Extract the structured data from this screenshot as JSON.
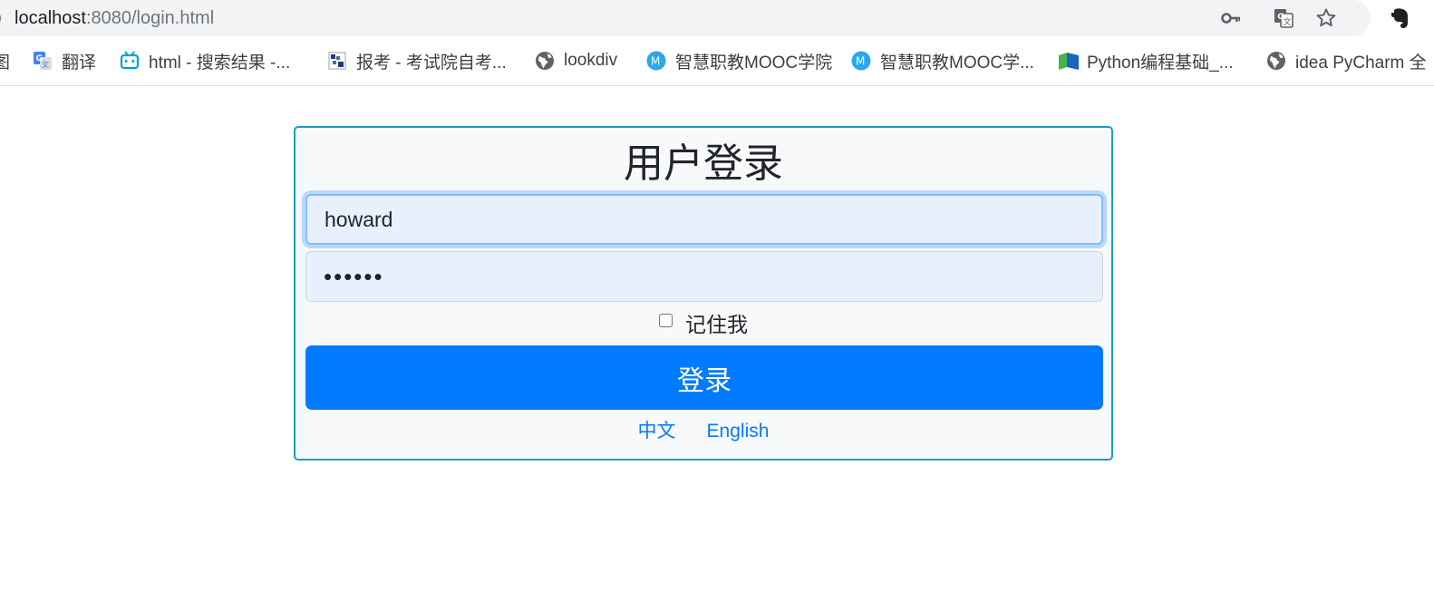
{
  "browser": {
    "url_host": "localhost",
    "url_path": ":8080/login.html",
    "icons": [
      "info-icon",
      "key-icon",
      "translate-icon",
      "star-icon",
      "evernote-icon"
    ]
  },
  "bookmarks": [
    {
      "label": "图",
      "icon": "image-icon"
    },
    {
      "label": "翻译",
      "icon": "google-translate-icon"
    },
    {
      "label": "html - 搜索结果 -...",
      "icon": "bilibili-icon"
    },
    {
      "label": "报考 - 考试院自考...",
      "icon": "site-icon"
    },
    {
      "label": "lookdiv",
      "icon": "globe-icon"
    },
    {
      "label": "智慧职教MOOC学院",
      "icon": "mooc-icon"
    },
    {
      "label": "智慧职教MOOC学...",
      "icon": "mooc-icon"
    },
    {
      "label": "Python编程基础_...",
      "icon": "flag-icon"
    },
    {
      "label": "idea PyCharm 全",
      "icon": "globe-icon"
    }
  ],
  "login": {
    "title": "用户登录",
    "username_value": "howard",
    "password_value": "••••••",
    "remember_label": "记住我",
    "remember_checked": false,
    "submit_label": "登录",
    "lang_zh": "中文",
    "lang_en": "English"
  },
  "colors": {
    "primary": "#007bff",
    "card_border": "#17a2b8",
    "card_background": "#f8f9fa",
    "autofill_background": "#e8f0fe"
  }
}
